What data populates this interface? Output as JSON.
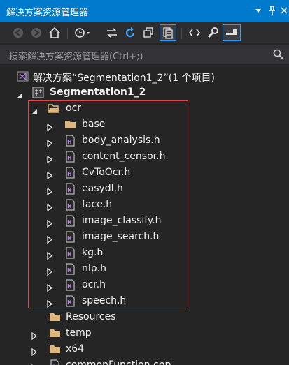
{
  "window": {
    "title": "解决方案资源管理器",
    "pin_icon": "pin-icon",
    "dropdown_icon": "dropdown-arrow-icon",
    "close_icon": "close-icon"
  },
  "toolbar": {
    "icons": [
      "back-icon",
      "forward-icon",
      "home-icon",
      "history-icon",
      "sync-icon",
      "refresh-icon",
      "collapse-all-icon",
      "show-all-files-icon",
      "view-code-icon",
      "properties-icon",
      "preview-icon"
    ]
  },
  "search": {
    "placeholder": "搜索解决方案资源管理器(Ctrl+;)"
  },
  "tree": {
    "solution": "解决方案“Segmentation1_2”(1 个项目)",
    "project": "Segmentation1_2",
    "ocr_folder": "ocr",
    "ocr_items": [
      {
        "label": "base",
        "type": "folder"
      },
      {
        "label": "body_analysis.h",
        "type": "header"
      },
      {
        "label": "content_censor.h",
        "type": "header"
      },
      {
        "label": "CvToOcr.h",
        "type": "header"
      },
      {
        "label": "easydl.h",
        "type": "header"
      },
      {
        "label": "face.h",
        "type": "header"
      },
      {
        "label": "image_classify.h",
        "type": "header"
      },
      {
        "label": "image_search.h",
        "type": "header"
      },
      {
        "label": "kg.h",
        "type": "header"
      },
      {
        "label": "nlp.h",
        "type": "header"
      },
      {
        "label": "ocr.h",
        "type": "header"
      },
      {
        "label": "speech.h",
        "type": "header"
      }
    ],
    "resources": "Resources",
    "temp": "temp",
    "x64": "x64",
    "cpp_file": "commonFunction.cpp"
  },
  "colors": {
    "accent": "#007acc",
    "background": "#252526",
    "folder": "#dcb67a",
    "highlight_box": "#e14848"
  }
}
